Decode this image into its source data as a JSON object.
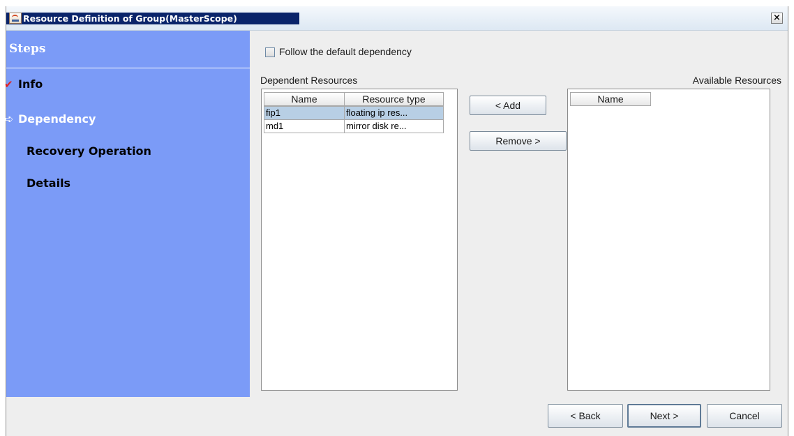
{
  "window": {
    "title": "Resource Definition of Group(MasterScope)",
    "close_label": "×"
  },
  "steps": {
    "header": "Steps",
    "items": [
      {
        "label": "Info",
        "icon": "check-icon",
        "state": "done"
      },
      {
        "label": "Dependency",
        "icon": "arrow-right-icon",
        "state": "current"
      },
      {
        "label": "Recovery Operation",
        "state": "pending"
      },
      {
        "label": "Details",
        "state": "pending"
      }
    ]
  },
  "follow_default": {
    "label": "Follow the default dependency",
    "checked": false
  },
  "dependent": {
    "label": "Dependent Resources",
    "columns": [
      "Name",
      "Resource type"
    ],
    "rows": [
      {
        "name": "fip1",
        "type": "floating ip res...",
        "selected": true
      },
      {
        "name": "md1",
        "type": "mirror disk re...",
        "selected": false
      }
    ]
  },
  "available": {
    "label": "Available Resources",
    "columns": [
      "Name"
    ],
    "rows": []
  },
  "buttons": {
    "add": "< Add",
    "remove": "Remove >",
    "back": "< Back",
    "next": "Next >",
    "cancel": "Cancel"
  },
  "colors": {
    "steps_bg": "#7b9bf7",
    "title_bg": "#0a246a",
    "selection": "#b8cfe5"
  }
}
